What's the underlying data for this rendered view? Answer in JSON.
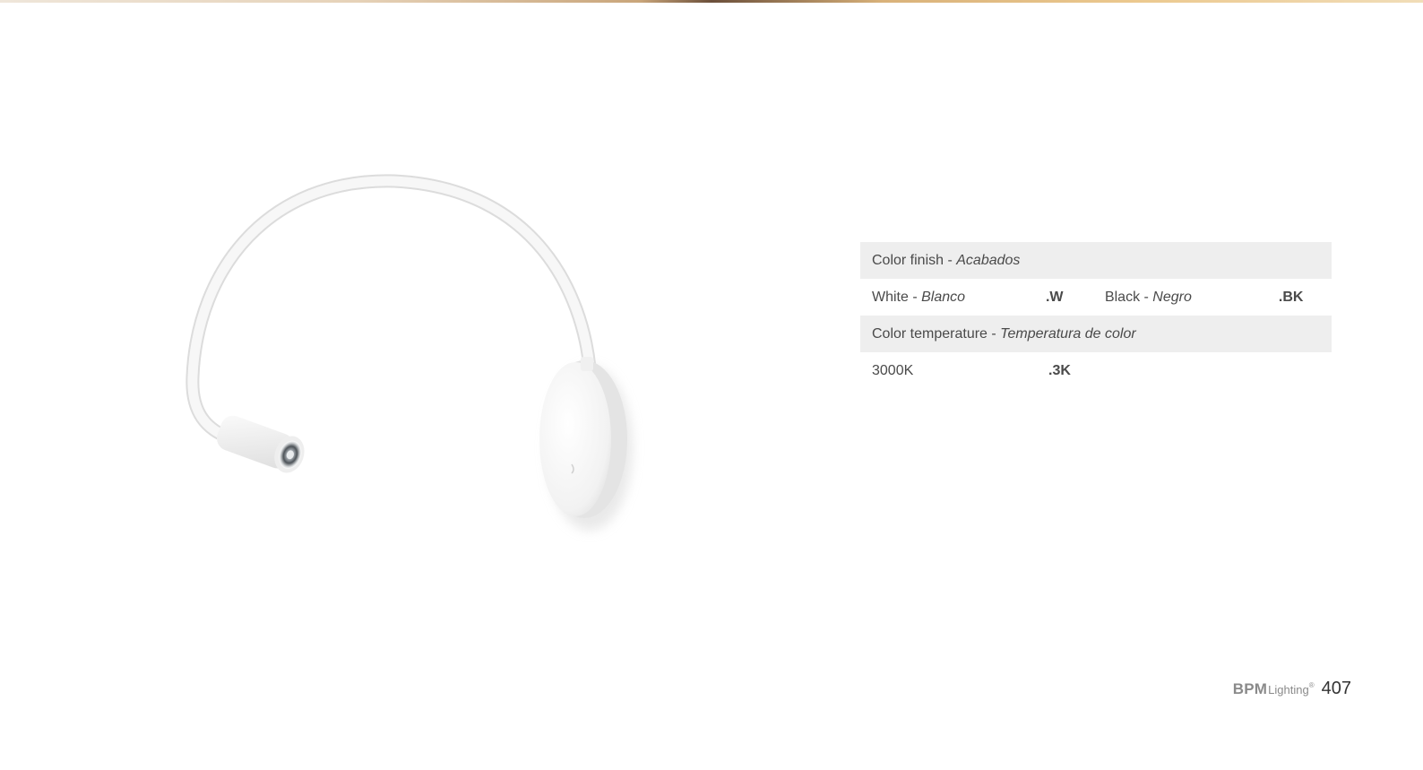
{
  "colors": {
    "header_bg": "#eeeeee",
    "text": "#4a4a4a",
    "brand": "#8a8a8a"
  },
  "spec_table": {
    "finish_header": {
      "en": "Color finish - ",
      "es": "Acabados"
    },
    "finishes": [
      {
        "en": "White - ",
        "es": "Blanco",
        "code": ".W"
      },
      {
        "en": "Black - ",
        "es": "Negro",
        "code": ".BK"
      }
    ],
    "temperature_header": {
      "en": "Color temperature - ",
      "es": "Temperatura de color"
    },
    "temperatures": [
      {
        "value": "3000K",
        "code": ".3K"
      }
    ]
  },
  "footer": {
    "brand_bpm": "BPM",
    "brand_lighting": "Lighting",
    "brand_reg": "®",
    "page_number": "407"
  },
  "icons": {
    "product": "wall-reading-lamp-image"
  }
}
